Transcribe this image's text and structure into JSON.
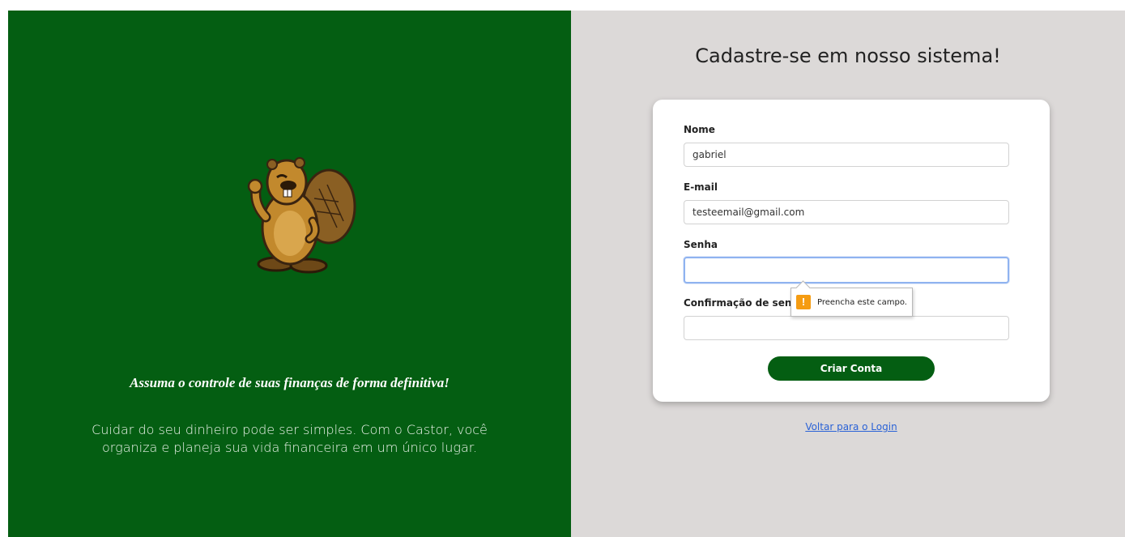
{
  "hero": {
    "tagline": "Assuma o controle de suas finanças de forma definitiva!",
    "description": "Cuidar do seu dinheiro pode ser simples. Com o Castor, você organiza e planeja sua vida financeira em um único lugar."
  },
  "form": {
    "title": "Cadastre-se em nosso sistema!",
    "name_label": "Nome",
    "name_value": "gabriel",
    "email_label": "E-mail",
    "email_value": "testeemail@gmail.com",
    "password_label": "Senha",
    "password_value": "",
    "confirm_label": "Confirmação de senha",
    "confirm_value": "",
    "submit_label": "Criar Conta",
    "validation_tooltip": "Preencha este campo.",
    "back_link": "Voltar para o Login"
  },
  "colors": {
    "brand_green": "#045e12",
    "panel_gray": "#dcd9d8",
    "link_blue": "#2a62d6",
    "warning_orange": "#f59c12"
  },
  "icons": {
    "mascot": "beaver-mascot-icon",
    "tooltip": "warning-icon"
  }
}
